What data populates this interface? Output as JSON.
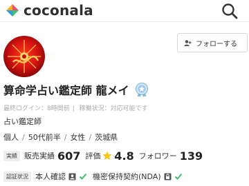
{
  "header": {
    "logo_text": "coconala",
    "logo_icon": "coconala-logo-icon",
    "search_icon": "search-icon"
  },
  "profile": {
    "avatar": "avatar-red-dragon-image",
    "follow_label": "フォローする",
    "follow_icon": "add-user-icon",
    "name": "算命学占い鑑定師 龍メイ",
    "rank_badge_icon": "rank-badge-icon",
    "last_login": "最終ログイン：8時間前",
    "activity_status": "稼働状況：対応可能です",
    "title": "占い鑑定師",
    "attributes": [
      "個人",
      "50代前半",
      "女性",
      "茨城県"
    ]
  },
  "stats": {
    "tag": "実績",
    "sales_label": "販売実績",
    "sales_value": "607",
    "rating_label": "評価",
    "rating_value": "4.8",
    "followers_label": "フォロワー",
    "followers_value": "139"
  },
  "auth": {
    "tag": "認証状況",
    "identity_label": "本人確認",
    "nda_label": "機密保持契約(NDA)"
  },
  "colors": {
    "accent_green": "#3fbf6f",
    "star_yellow": "#f5c518",
    "logo_text": "#2f2f2f"
  }
}
